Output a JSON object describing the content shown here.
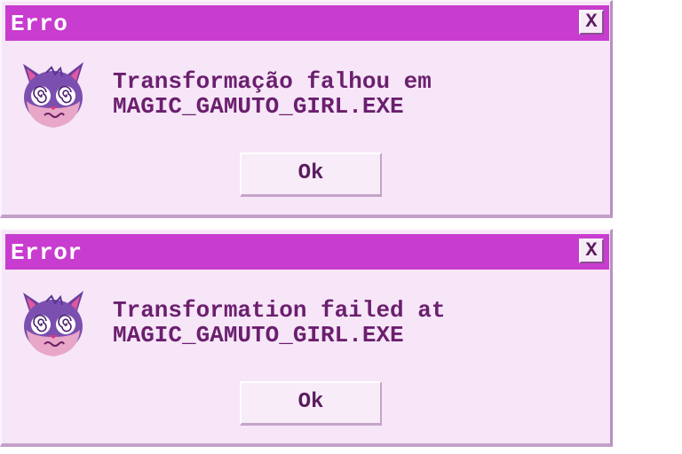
{
  "dialogs": [
    {
      "title": "Erro",
      "close_label": "X",
      "icon": "dizzy-cat-icon",
      "message_line1": "Transformação falhou em",
      "message_line2": "MAGIC_GAMUTO_GIRL.EXE",
      "ok_label": "Ok"
    },
    {
      "title": "Error",
      "close_label": "X",
      "icon": "dizzy-cat-icon",
      "message_line1": "Transformation failed at",
      "message_line2": "MAGIC_GAMUTO_GIRL.EXE",
      "ok_label": "Ok"
    }
  ],
  "colors": {
    "titlebar": "#c83ccf",
    "dialog_bg": "#f6e6f8",
    "text": "#6b1f6e",
    "cat_fur": "#7a4fb0",
    "cat_face": "#e8a6c8"
  }
}
